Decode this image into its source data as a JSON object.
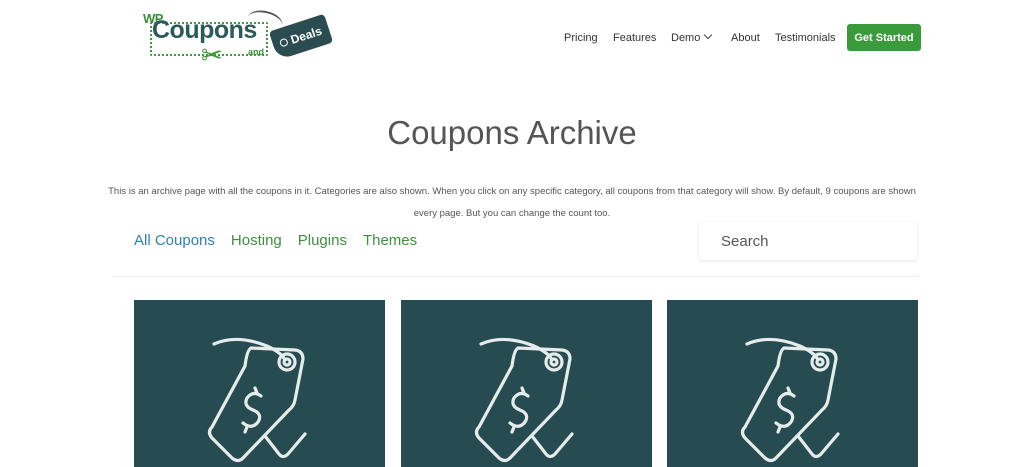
{
  "brand": {
    "logo_wp": "WP",
    "logo_coupons": "Coupons",
    "logo_and": "and",
    "logo_deals": "Deals"
  },
  "nav": {
    "items": [
      {
        "label": "Pricing"
      },
      {
        "label": "Features"
      },
      {
        "label": "Demo",
        "has_dropdown": true
      },
      {
        "label": "About"
      },
      {
        "label": "Testimonials"
      }
    ],
    "cta_label": "Get Started"
  },
  "page": {
    "title": "Coupons Archive",
    "description": "This is an archive page with all the coupons in it. Categories are also shown. When you click on any specific category, all coupons from that category will show. By default, 9 coupons are shown every page. But you can change the count too."
  },
  "filters": {
    "items": [
      {
        "label": "All Coupons",
        "active": true
      },
      {
        "label": "Hosting",
        "active": false
      },
      {
        "label": "Plugins",
        "active": false
      },
      {
        "label": "Themes",
        "active": false
      }
    ]
  },
  "search": {
    "placeholder": "Search",
    "value": ""
  },
  "cards": [
    {
      "icon": "price-tag-dollar-icon"
    },
    {
      "icon": "price-tag-dollar-icon"
    },
    {
      "icon": "price-tag-dollar-icon"
    }
  ],
  "colors": {
    "accent_green": "#3a9b3b",
    "link_blue": "#2f7fb8",
    "card_bg": "#264c52",
    "icon_stroke": "#e6ecec"
  }
}
